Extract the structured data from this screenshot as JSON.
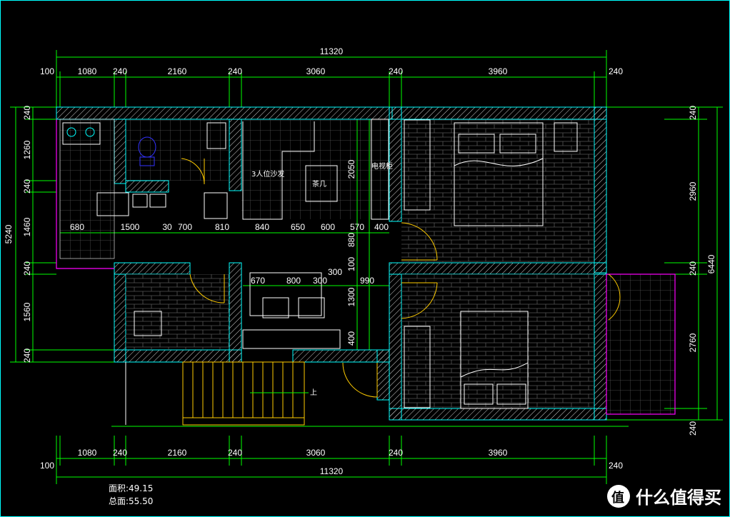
{
  "dims": {
    "top_total": "11320",
    "top_segments": [
      "100",
      "1080",
      "240",
      "2160",
      "240",
      "3060",
      "240",
      "3960",
      "240"
    ],
    "bottom_total": "11320",
    "bottom_segments": [
      "100",
      "1080",
      "240",
      "2160",
      "240",
      "3060",
      "240",
      "3960",
      "240"
    ],
    "left_total": "5240",
    "left_segments": [
      "240",
      "1260",
      "240",
      "1460",
      "240",
      "1560",
      "240"
    ],
    "right_total": "6440",
    "right_segments": [
      "240",
      "2960",
      "240",
      "2760",
      "240"
    ],
    "inner_row": [
      "680",
      "1500",
      "30",
      "700",
      "810",
      "840",
      "650",
      "600",
      "570",
      "400"
    ],
    "inner_col": [
      "2050",
      "880",
      "100",
      "1300",
      "400"
    ],
    "dining_row": [
      "670",
      "800",
      "300"
    ],
    "dining_extra": [
      "300",
      "990"
    ]
  },
  "labels": {
    "sofa": "3人位沙发",
    "tea_table": "茶几",
    "tv_cabinet": "电视柜",
    "stairs_up": "上"
  },
  "area": {
    "usable_label": "面积:",
    "usable_value": "49.15",
    "total_label": "总面:",
    "total_value": "55.50"
  },
  "watermark": {
    "badge": "值",
    "text": "什么值得买"
  },
  "colors": {
    "dim_line": "#00ff00",
    "wall": "#ffffff",
    "wall_outline": "#00ffff",
    "door": "#ffcc00",
    "balcony": "#ff00ff",
    "grid": "#555555",
    "furniture": "#ffffff",
    "accent": "#0033ff"
  }
}
